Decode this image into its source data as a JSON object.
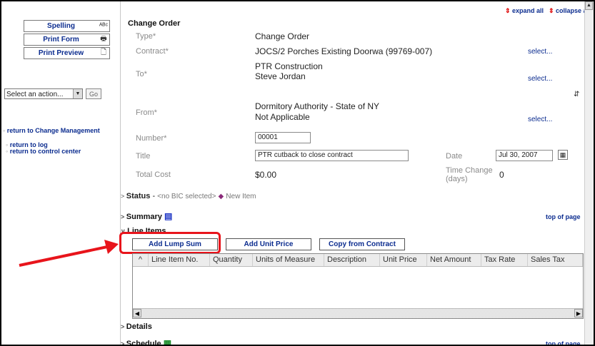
{
  "sidebar": {
    "buttons": [
      {
        "label": "Spelling",
        "icon": "spell-check-icon",
        "glyph": "ᴬᴮᶜ"
      },
      {
        "label": "Print Form",
        "icon": "printer-icon",
        "glyph": "🖶"
      },
      {
        "label": "Print Preview",
        "icon": "print-preview-icon",
        "glyph": "🗋"
      }
    ],
    "action_select": "Select an action...",
    "go_label": "Go",
    "links": [
      "return to Change Management",
      "return to log",
      "return to control center"
    ]
  },
  "top": {
    "expand_all": "expand all",
    "collapse_all": "collapse all"
  },
  "form": {
    "title": "Change Order",
    "type_label": "Type*",
    "type_value": "Change Order",
    "contract_label": "Contract*",
    "contract_value": "JOCS/2 Porches Existing Doorwa (99769-007)",
    "to_label": "To*",
    "to_line1": "PTR Construction",
    "to_line2": "Steve Jordan",
    "from_label": "From*",
    "from_line1": "Dormitory Authority - State of NY",
    "from_line2": "Not Applicable",
    "select_link": "select...",
    "number_label": "Number*",
    "number_value": "00001",
    "title_label": "Title",
    "title_value": "PTR cutback to close contract",
    "date_label": "Date",
    "date_value": "Jul 30, 2007",
    "total_cost_label": "Total Cost",
    "total_cost_value": "$0.00",
    "time_change_label_1": "Time Change",
    "time_change_label_2": "(days)",
    "time_change_value": "0"
  },
  "status": {
    "label": "Status",
    "dash": " - ",
    "bic": "<no BIC selected>",
    "new_item": "New Item"
  },
  "sections": {
    "summary": "Summary",
    "line_items": "Line Items",
    "details": "Details",
    "schedule": "Schedule",
    "top_of_page": "top of page"
  },
  "line_items": {
    "buttons": [
      "Add Lump Sum",
      "Add Unit Price",
      "Copy from Contract"
    ],
    "columns": [
      "Line Item No.",
      "Quantity",
      "Units of Measure",
      "Description",
      "Unit Price",
      "Net Amount",
      "Tax Rate",
      "Sales Tax"
    ]
  },
  "colors": {
    "link": "#0b2c8f",
    "highlight": "#e8141b"
  }
}
